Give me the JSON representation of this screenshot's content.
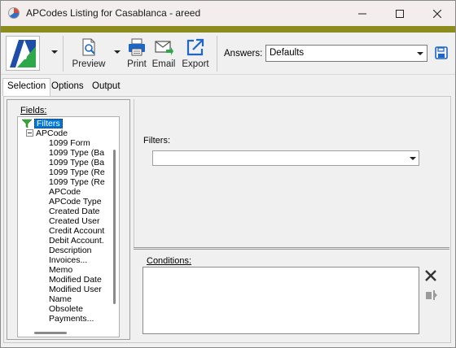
{
  "window": {
    "title": "APCodes Listing for Casablanca - areed"
  },
  "toolbar": {
    "preview_label": "Preview",
    "print_label": "Print",
    "email_label": "Email",
    "export_label": "Export",
    "answers_label": "Answers:",
    "answers_value": "Defaults",
    "accent_color": "#8c8c1e"
  },
  "tabs": [
    {
      "label": "Selection",
      "active": true
    },
    {
      "label": "Options",
      "active": false
    },
    {
      "label": "Output",
      "active": false
    }
  ],
  "fields_panel": {
    "label": "Fields:",
    "root": "Filters",
    "group": "APCode",
    "items": [
      "1099 Form",
      "1099 Type (Ba",
      "1099 Type (Ba",
      "1099 Type (Re",
      "1099 Type (Re",
      "APCode",
      "APCode Type",
      "Created Date",
      "Created User",
      "Credit Account",
      "Debit Account.",
      "Description",
      "Invoices...",
      "Memo",
      "Modified Date",
      "Modified User",
      "Name",
      "Obsolete",
      "Payments..."
    ]
  },
  "filters": {
    "label": "Filters:",
    "value": ""
  },
  "conditions": {
    "label": "Conditions:"
  }
}
